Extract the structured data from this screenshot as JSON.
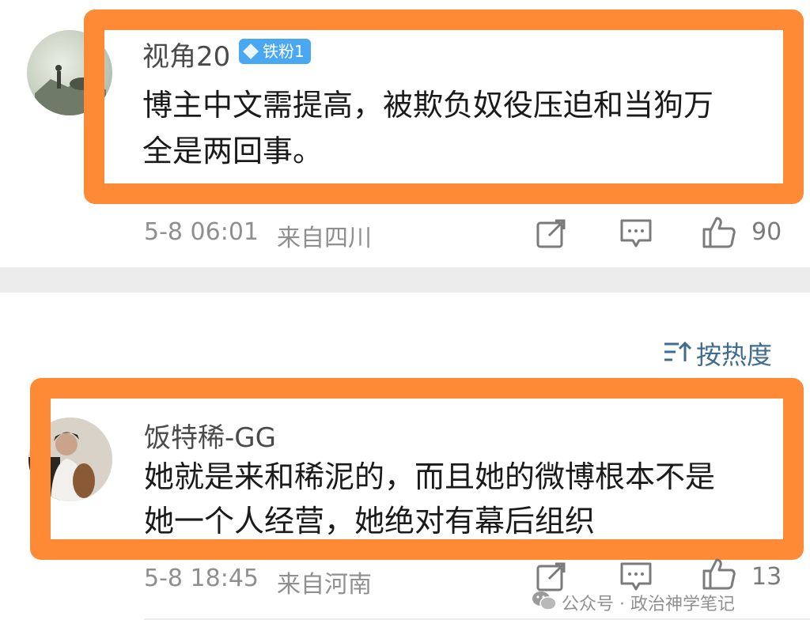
{
  "comments": [
    {
      "username": "视角20",
      "badge": "铁粉1",
      "text_line1": "博主中文需提高，被欺负奴役压迫和当狗万",
      "text_line2": "全是两回事。",
      "date": "5-8 06:01",
      "location": "来自四川",
      "likes": "90"
    },
    {
      "username": "饭特稀-GG",
      "text_line1": "她就是来和稀泥的，而且她的微博根本不是",
      "text_line2": "她一个人经营，她绝对有幕后组织",
      "date": "5-8 18:45",
      "location": "来自河南",
      "likes": "13"
    }
  ],
  "sort": {
    "label": "按热度",
    "icon": "sort-icon"
  },
  "watermark": {
    "text": "公众号 · 政治神学笔记",
    "icon": "wechat-icon"
  },
  "colors": {
    "highlight": "#ff8a35",
    "badge": "#4aa7f2",
    "sort": "#3f6c8f"
  },
  "icons": [
    "share-icon",
    "comment-icon",
    "like-icon"
  ]
}
